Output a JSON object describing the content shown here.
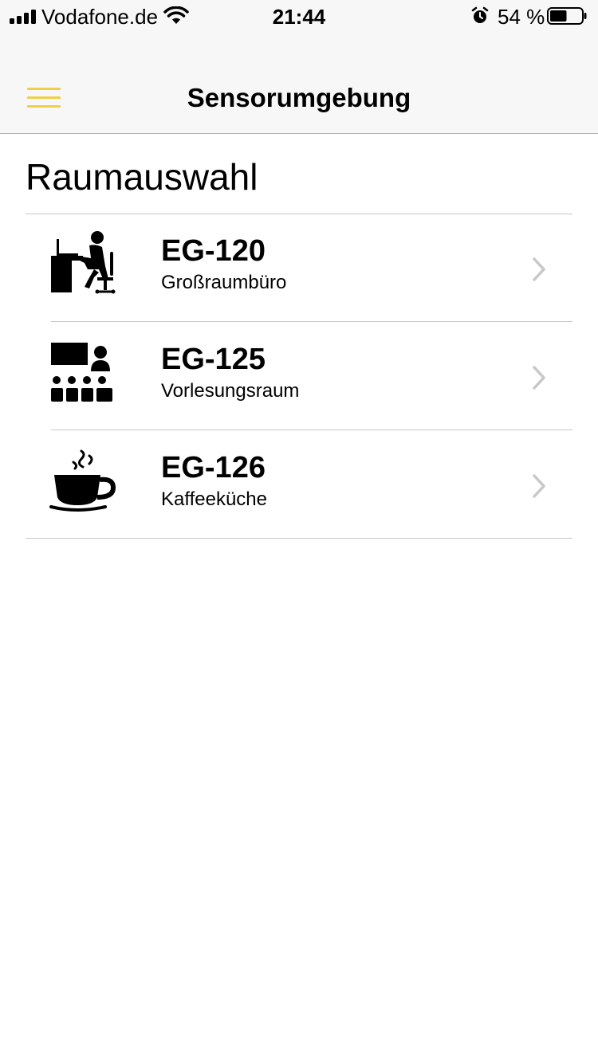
{
  "status_bar": {
    "carrier": "Vodafone.de",
    "time": "21:44",
    "battery_text": "54 %",
    "battery_level": 0.54,
    "icons": [
      "signal-icon",
      "wifi-icon",
      "alarm-icon",
      "battery-icon"
    ]
  },
  "nav": {
    "title": "Sensorumgebung",
    "menu_icon": "hamburger-menu-icon",
    "accent_color": "#f2cf47"
  },
  "section_title": "Raumauswahl",
  "rooms": [
    {
      "title": "EG-120",
      "subtitle": "Großraumbüro",
      "icon": "office-desk-icon"
    },
    {
      "title": "EG-125",
      "subtitle": "Vorlesungsraum",
      "icon": "lecture-room-icon"
    },
    {
      "title": "EG-126",
      "subtitle": "Kaffeeküche",
      "icon": "coffee-cup-icon"
    }
  ],
  "colors": {
    "nav_background": "#f7f7f7",
    "separator": "#c8c8c8",
    "chevron": "#c7c7cc"
  }
}
